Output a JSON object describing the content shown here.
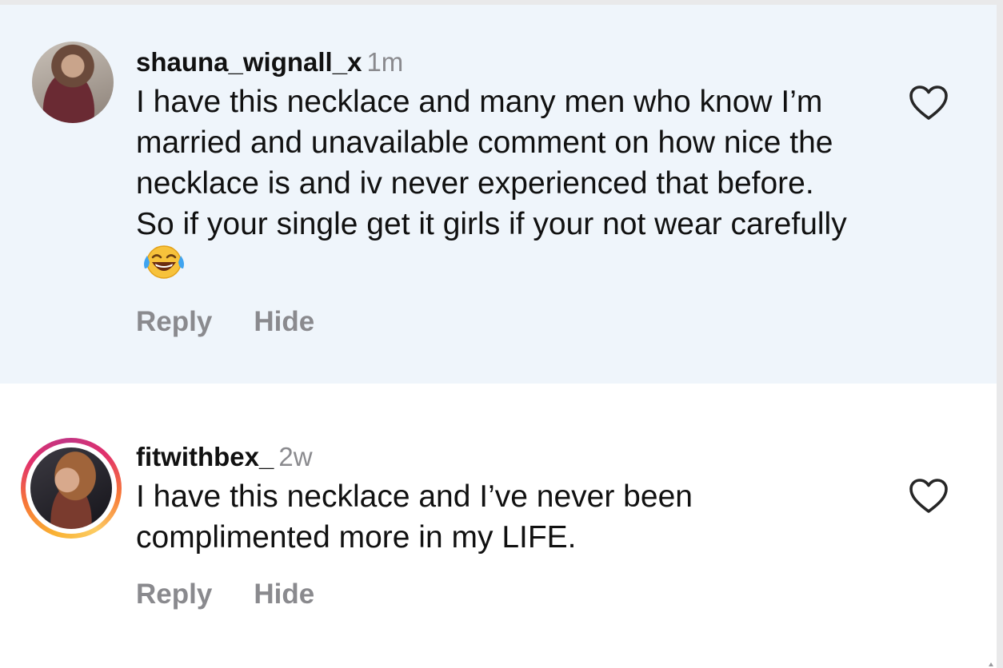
{
  "comments": [
    {
      "username": "shauna_wignall_x",
      "time": "1m",
      "text": "I have this necklace and many men who know I’m married and unavailable comment on how nice the necklace is and iv never experienced that before. So if your single get it girls if your not wear carefully",
      "emoji": "face-with-tears-of-joy",
      "reply_label": "Reply",
      "hide_label": "Hide",
      "highlighted": true
    },
    {
      "username": "fitwithbex_",
      "time": "2w",
      "text": "I have this necklace and I’ve never been complimented more in my LIFE.",
      "reply_label": "Reply",
      "hide_label": "Hide",
      "story_ring": true
    }
  ],
  "colors": {
    "highlight_bg": "#eff5fb",
    "secondary_text": "#8a8a8e",
    "primary_text": "#111111"
  },
  "icons": [
    "heart-outline-icon",
    "face-with-tears-of-joy-emoji"
  ]
}
